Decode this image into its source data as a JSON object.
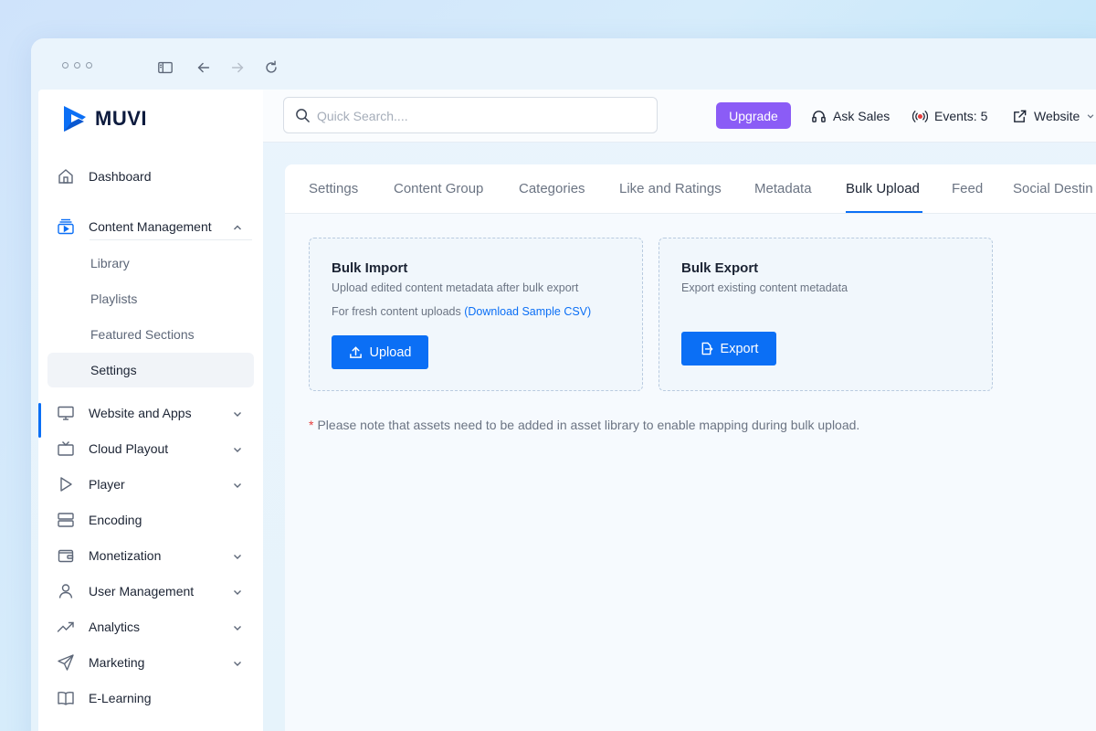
{
  "brand": {
    "name": "MUVI",
    "accent": "#0b6ff5"
  },
  "sidebar": {
    "items": [
      {
        "label": "Dashboard",
        "icon": "home-icon"
      },
      {
        "label": "Content Management",
        "icon": "video-library-icon",
        "expanded": true,
        "children": [
          "Library",
          "Playlists",
          "Featured Sections",
          "Settings"
        ],
        "active_child": "Settings"
      },
      {
        "label": "Website and Apps",
        "icon": "monitor-icon"
      },
      {
        "label": "Cloud Playout",
        "icon": "tv-icon"
      },
      {
        "label": "Player",
        "icon": "play-icon"
      },
      {
        "label": "Encoding",
        "icon": "server-icon"
      },
      {
        "label": "Monetization",
        "icon": "wallet-icon"
      },
      {
        "label": "User Management",
        "icon": "user-icon"
      },
      {
        "label": "Analytics",
        "icon": "trend-up-icon"
      },
      {
        "label": "Marketing",
        "icon": "send-icon"
      },
      {
        "label": "E-Learning",
        "icon": "book-icon"
      }
    ]
  },
  "topbar": {
    "search_placeholder": "Quick Search....",
    "upgrade_label": "Upgrade",
    "upgrade_color": "#8b5cf6",
    "ask_sales_label": "Ask Sales",
    "events_label": "Events: 5",
    "website_label": "Website"
  },
  "tabs": {
    "items": [
      "Settings",
      "Content Group",
      "Categories",
      "Like and Ratings",
      "Metadata",
      "Bulk Upload",
      "Feed",
      "Social Destin"
    ],
    "active": "Bulk Upload"
  },
  "bulk_import": {
    "title": "Bulk Import",
    "description": "Upload edited content metadata after bulk export",
    "fresh_text": "For fresh content uploads",
    "sample_link": "(Download Sample CSV)",
    "button_label": "Upload"
  },
  "bulk_export": {
    "title": "Bulk Export",
    "description": "Export existing content metadata",
    "button_label": "Export"
  },
  "note": {
    "marker": "*",
    "text": "Please note that assets need to be added in asset library to enable mapping during bulk upload."
  }
}
